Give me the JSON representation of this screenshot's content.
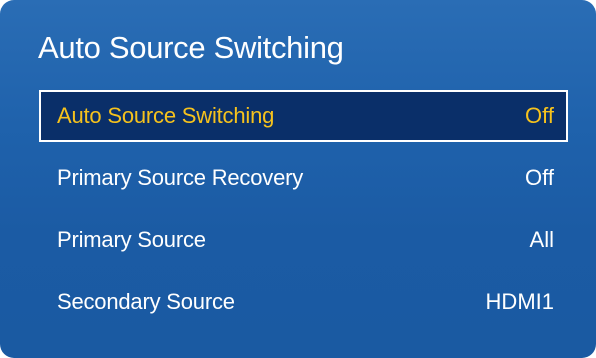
{
  "panel": {
    "title": "Auto Source Switching"
  },
  "menu": {
    "items": [
      {
        "label": "Auto Source Switching",
        "value": "Off",
        "selected": true
      },
      {
        "label": "Primary Source Recovery",
        "value": "Off",
        "selected": false
      },
      {
        "label": "Primary Source",
        "value": "All",
        "selected": false
      },
      {
        "label": "Secondary Source",
        "value": "HDMI1",
        "selected": false
      }
    ]
  },
  "colors": {
    "panel_background": "#1f62ac",
    "selected_background": "#0a2f69",
    "selected_text": "#f6c21d",
    "text": "#ffffff"
  }
}
